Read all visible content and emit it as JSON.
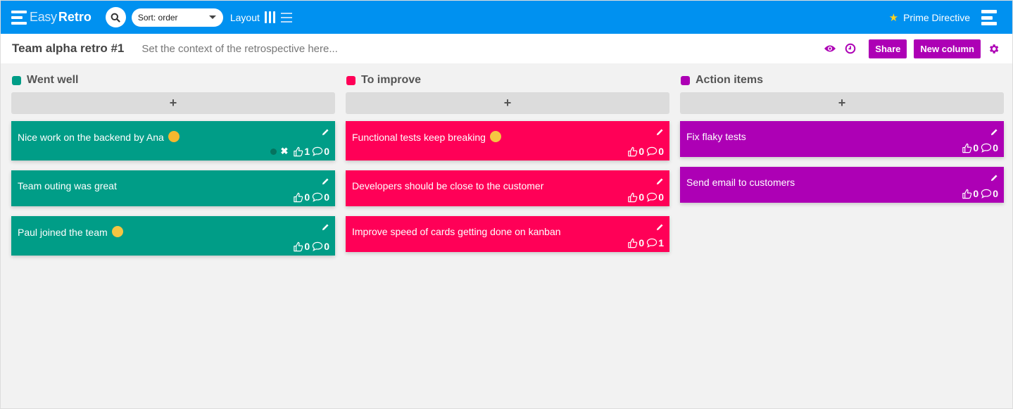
{
  "app": {
    "logo_light": "Easy",
    "logo_bold": "Retro",
    "sort_label": "Sort: order",
    "layout_label": "Layout",
    "prime_directive": "Prime Directive"
  },
  "board": {
    "title": "Team alpha retro #1",
    "context_placeholder": "Set the context of the retrospective here...",
    "share_label": "Share",
    "new_column_label": "New column"
  },
  "colors": {
    "topbar": "#0091f0",
    "went_well": "#009d87",
    "to_improve": "#ff0057",
    "action_items": "#ad00b5"
  },
  "columns": [
    {
      "title": "Went well",
      "add_label": "+",
      "cards": [
        {
          "text": "Nice work on the backend by Ana",
          "emoji": "thumbs-up",
          "likes": "1",
          "comments": "0",
          "voted": true
        },
        {
          "text": "Team outing was great",
          "emoji": "",
          "likes": "0",
          "comments": "0"
        },
        {
          "text": "Paul joined the team",
          "emoji": "grinning-face",
          "likes": "0",
          "comments": "0"
        }
      ]
    },
    {
      "title": "To improve",
      "add_label": "+",
      "cards": [
        {
          "text": "Functional tests keep breaking",
          "emoji": "crying-face",
          "likes": "0",
          "comments": "0"
        },
        {
          "text": "Developers should be close to the customer",
          "emoji": "",
          "likes": "0",
          "comments": "0"
        },
        {
          "text": "Improve speed of cards getting done on kanban",
          "emoji": "",
          "likes": "0",
          "comments": "1"
        }
      ]
    },
    {
      "title": "Action items",
      "add_label": "+",
      "cards": [
        {
          "text": "Fix flaky tests",
          "emoji": "",
          "likes": "0",
          "comments": "0"
        },
        {
          "text": "Send email to customers",
          "emoji": "",
          "likes": "0",
          "comments": "0"
        }
      ]
    }
  ]
}
